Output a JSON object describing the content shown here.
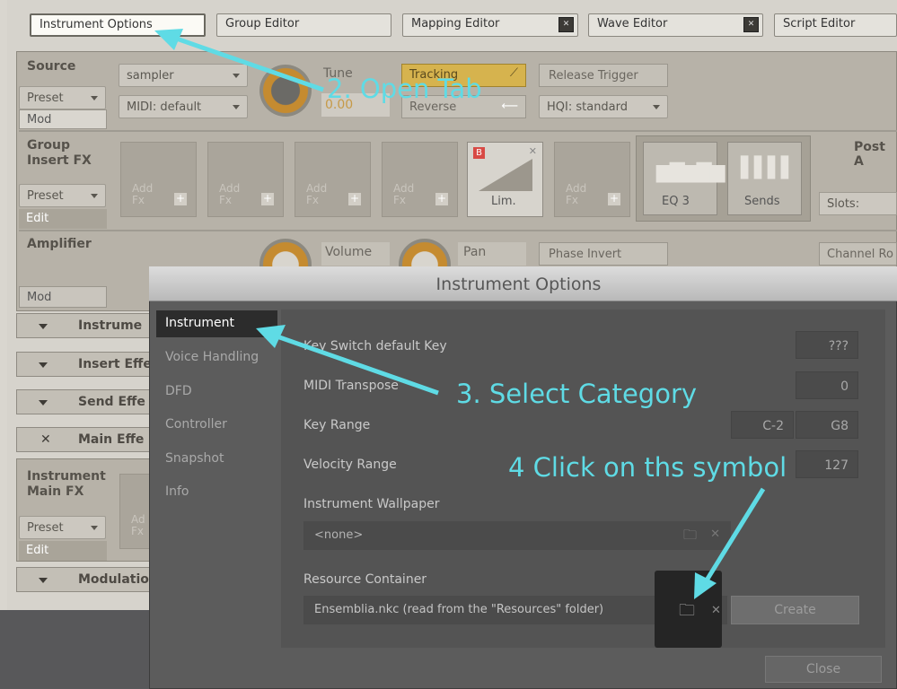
{
  "tabs": [
    {
      "label": "Instrument Options",
      "active": true
    },
    {
      "label": "Group Editor"
    },
    {
      "label": "Mapping Editor",
      "close_icon": "x-square-icon"
    },
    {
      "label": "Wave Editor",
      "close_icon": "x-square-icon"
    },
    {
      "label": "Script Editor"
    }
  ],
  "source": {
    "title": "Source",
    "preset": "Preset",
    "mod": "Mod",
    "sampler": "sampler",
    "midi": "MIDI: default",
    "tune_label": "Tune",
    "tune_value": "0.00",
    "tracking": "Tracking",
    "reverse": "Reverse",
    "release_trigger": "Release Trigger",
    "hqi": "HQI: standard"
  },
  "group_fx": {
    "title_line1": "Group",
    "title_line2": "Insert FX",
    "preset": "Preset",
    "edit": "Edit",
    "add_fx_line1": "Add",
    "add_fx_line2": "Fx",
    "lim": "Lim.",
    "eq3": "EQ 3",
    "sends": "Sends",
    "post_amp": "Post A",
    "slots": "Slots:"
  },
  "amplifier": {
    "title": "Amplifier",
    "volume": "Volume",
    "pan": "Pan",
    "phase_invert": "Phase Invert",
    "channel_routing": "Channel Ro",
    "mod": "Mod"
  },
  "rows": [
    "Instrume",
    "Insert Effe",
    "Send Effe",
    "Main Effe",
    "Modulatio"
  ],
  "main_fx": {
    "title_line1": "Instrument",
    "title_line2": "Main FX",
    "preset": "Preset",
    "edit": "Edit",
    "add_stub1": "Ad",
    "add_stub2": "Fx"
  },
  "dialog": {
    "title": "Instrument Options",
    "categories": [
      "Instrument",
      "Voice Handling",
      "DFD",
      "Controller",
      "Snapshot",
      "Info"
    ],
    "selected": "Instrument",
    "key_switch_label": "Key Switch default Key",
    "key_switch_value": "???",
    "midi_transpose_label": "MIDI Transpose",
    "midi_transpose_value": "0",
    "key_range_label": "Key Range",
    "key_range_low": "C-2",
    "key_range_high": "G8",
    "velocity_range_label": "Velocity Range",
    "velocity_high": "127",
    "wallpaper_label": "Instrument Wallpaper",
    "wallpaper_value": "<none>",
    "resource_label": "Resource Container",
    "resource_value": "Ensemblia.nkc  (read from the \"Resources\" folder)",
    "create": "Create",
    "close": "Close"
  },
  "annotations": {
    "step2": "2. Open Tab",
    "step3": "3. Select Category",
    "step4": "4 Click on ths symbol",
    "color": "#5fdbe5"
  }
}
